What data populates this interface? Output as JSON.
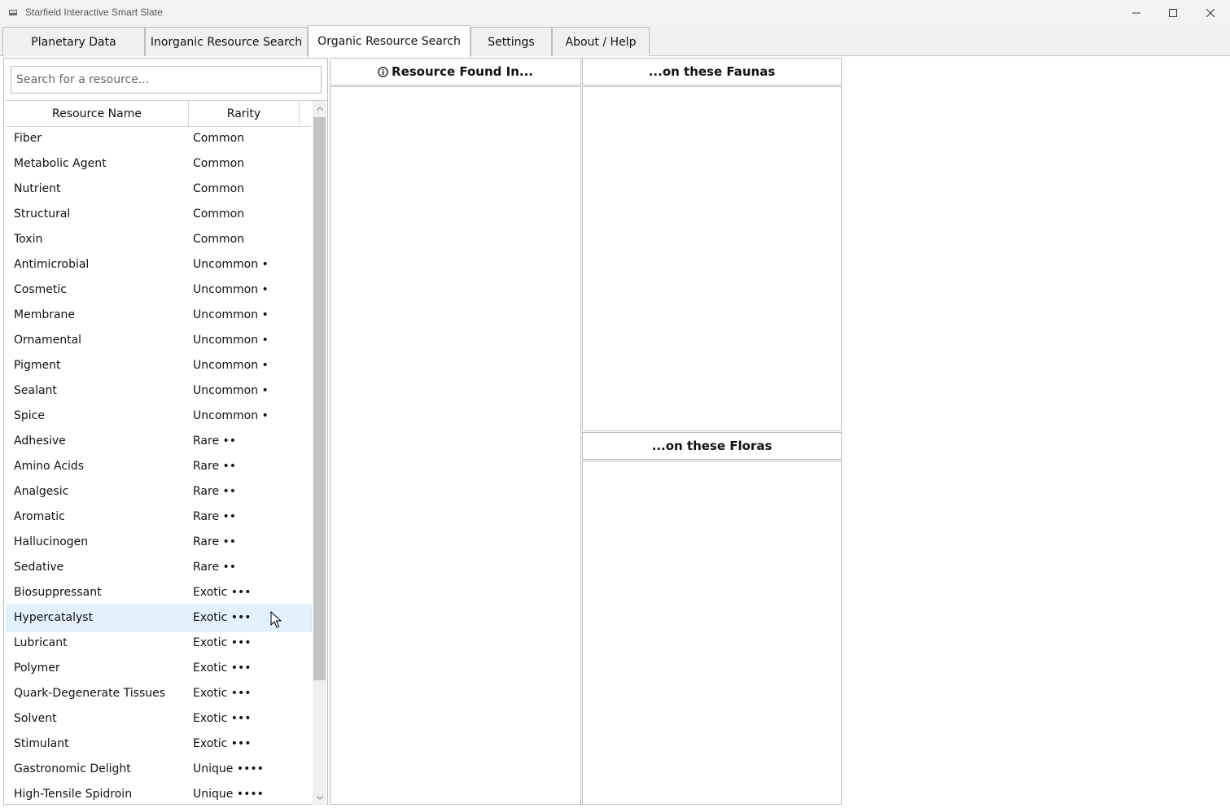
{
  "window": {
    "title": "Starfield Interactive Smart Slate",
    "controls": [
      "minimize-icon",
      "maximize-icon",
      "close-icon"
    ]
  },
  "tabs": [
    {
      "label": "Planetary Data",
      "active": false
    },
    {
      "label": "Inorganic Resource Search",
      "active": false
    },
    {
      "label": "Organic Resource Search",
      "active": true
    },
    {
      "label": "Settings",
      "active": false
    },
    {
      "label": "About / Help",
      "active": false
    }
  ],
  "search": {
    "placeholder": "Search for a resource...",
    "value": ""
  },
  "table": {
    "columns": [
      "Resource Name",
      "Rarity"
    ],
    "selected_index": 19,
    "rows": [
      {
        "name": "Fiber",
        "rarity": "Common"
      },
      {
        "name": "Metabolic Agent",
        "rarity": "Common"
      },
      {
        "name": "Nutrient",
        "rarity": "Common"
      },
      {
        "name": "Structural",
        "rarity": "Common"
      },
      {
        "name": "Toxin",
        "rarity": "Common"
      },
      {
        "name": "Antimicrobial",
        "rarity": "Uncommon •"
      },
      {
        "name": "Cosmetic",
        "rarity": "Uncommon •"
      },
      {
        "name": "Membrane",
        "rarity": "Uncommon •"
      },
      {
        "name": "Ornamental",
        "rarity": "Uncommon •"
      },
      {
        "name": "Pigment",
        "rarity": "Uncommon •"
      },
      {
        "name": "Sealant",
        "rarity": "Uncommon •"
      },
      {
        "name": "Spice",
        "rarity": "Uncommon •"
      },
      {
        "name": "Adhesive",
        "rarity": "Rare ••"
      },
      {
        "name": "Amino Acids",
        "rarity": "Rare ••"
      },
      {
        "name": "Analgesic",
        "rarity": "Rare ••"
      },
      {
        "name": "Aromatic",
        "rarity": "Rare ••"
      },
      {
        "name": "Hallucinogen",
        "rarity": "Rare ••"
      },
      {
        "name": "Sedative",
        "rarity": "Rare ••"
      },
      {
        "name": "Biosuppressant",
        "rarity": "Exotic •••"
      },
      {
        "name": "Hypercatalyst",
        "rarity": "Exotic •••"
      },
      {
        "name": "Lubricant",
        "rarity": "Exotic •••"
      },
      {
        "name": "Polymer",
        "rarity": "Exotic •••"
      },
      {
        "name": "Quark-Degenerate Tissues",
        "rarity": "Exotic •••"
      },
      {
        "name": "Solvent",
        "rarity": "Exotic •••"
      },
      {
        "name": "Stimulant",
        "rarity": "Exotic •••"
      },
      {
        "name": "Gastronomic Delight",
        "rarity": "Unique ••••"
      },
      {
        "name": "High-Tensile Spidroin",
        "rarity": "Unique ••••"
      }
    ]
  },
  "panels": {
    "found_in": {
      "title": "Resource Found In...",
      "icon": "info-icon"
    },
    "faunas": {
      "title": "...on these Faunas"
    },
    "floras": {
      "title": "...on these Floras"
    }
  }
}
